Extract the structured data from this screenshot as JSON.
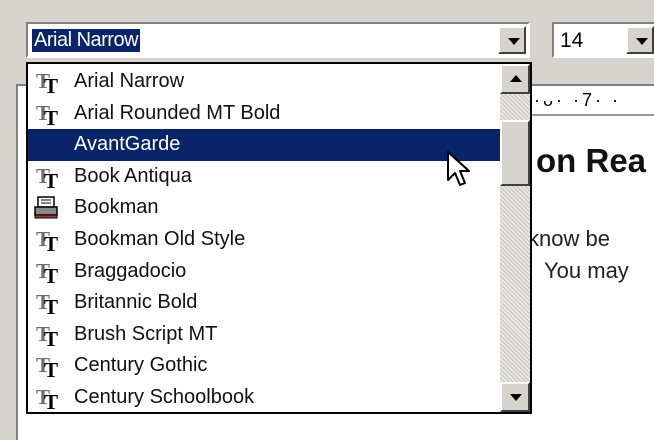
{
  "toolbar": {
    "font_value": "Arial Narrow",
    "size_value": "14"
  },
  "font_list": {
    "items": [
      {
        "label": "Arial Narrow",
        "icon": "truetype-icon"
      },
      {
        "label": "Arial Rounded MT Bold",
        "icon": "truetype-icon"
      },
      {
        "label": "AvantGarde",
        "icon": "none",
        "selected": true
      },
      {
        "label": "Book Antiqua",
        "icon": "truetype-icon"
      },
      {
        "label": "Bookman",
        "icon": "printer-font-icon"
      },
      {
        "label": "Bookman Old Style",
        "icon": "truetype-icon"
      },
      {
        "label": "Braggadocio",
        "icon": "truetype-icon"
      },
      {
        "label": "Britannic Bold",
        "icon": "truetype-icon"
      },
      {
        "label": "Brush Script MT",
        "icon": "truetype-icon"
      },
      {
        "label": "Century Gothic",
        "icon": "truetype-icon"
      },
      {
        "label": "Century Schoolbook",
        "icon": "truetype-icon"
      }
    ]
  },
  "document": {
    "ruler_text": "·ᴗ· ·7· ·",
    "heading": "on Rea",
    "line1": "know be",
    "line2": "You may"
  },
  "colors": {
    "selection": "#0a246a",
    "chrome": "#d6d3ce"
  }
}
